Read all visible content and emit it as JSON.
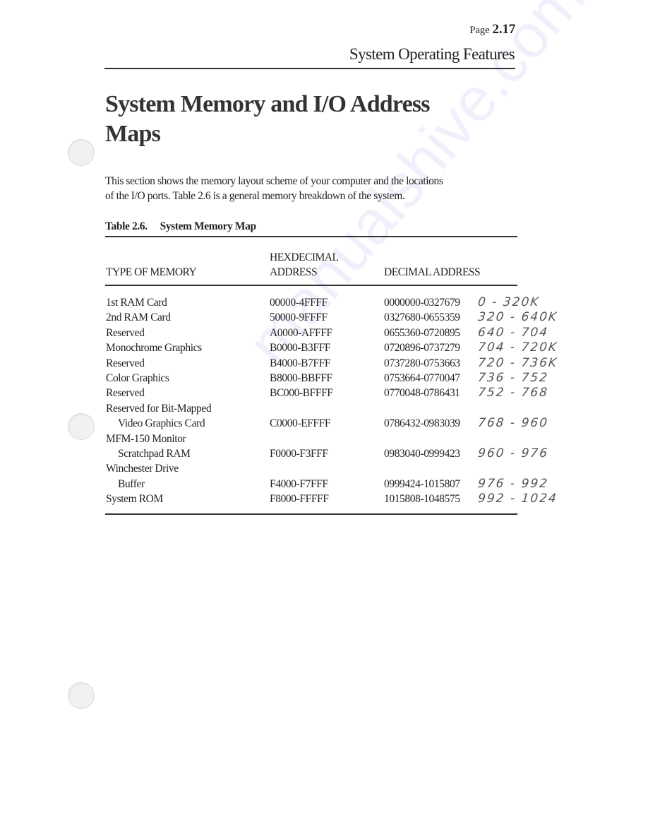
{
  "header": {
    "page_label": "Page",
    "page_number": "2.17",
    "section_title": "System Operating Features"
  },
  "title": {
    "line1": "System Memory and I/O Address",
    "line2": "Maps"
  },
  "intro": {
    "line1": "This section shows the memory layout scheme of your computer and the locations",
    "line2": "of the I/O ports. Table 2.6 is a general memory breakdown of the system."
  },
  "table": {
    "caption_number": "Table 2.6.",
    "caption_title": "System Memory Map",
    "headers": {
      "type": "TYPE OF MEMORY",
      "hex_line1": "HEXDECIMAL",
      "hex_line2": "ADDRESS",
      "decimal": "DECIMAL ADDRESS"
    },
    "rows": [
      {
        "type": "1st RAM Card",
        "hex": "00000-4FFFF",
        "decimal": "0000000-0327679",
        "note": "0 - 320K"
      },
      {
        "type": "2nd RAM Card",
        "hex": "50000-9FFFF",
        "decimal": "0327680-0655359",
        "note": "320 - 640K"
      },
      {
        "type": "Reserved",
        "hex": "A0000-AFFFF",
        "decimal": "0655360-0720895",
        "note": "640 - 704"
      },
      {
        "type": "Monochrome Graphics",
        "hex": "B0000-B3FFF",
        "decimal": "0720896-0737279",
        "note": "704 - 720K"
      },
      {
        "type": "Reserved",
        "hex": "B4000-B7FFF",
        "decimal": "0737280-0753663",
        "note": "720 - 736K"
      },
      {
        "type": "Color Graphics",
        "hex": "B8000-BBFFF",
        "decimal": "0753664-0770047",
        "note": "736 - 752"
      },
      {
        "type": "Reserved",
        "hex": "BC000-BFFFF",
        "decimal": "0770048-0786431",
        "note": "752 - 768"
      },
      {
        "type": "Reserved for Bit-Mapped",
        "type2": "Video Graphics Card",
        "hex": "C0000-EFFFF",
        "decimal": "0786432-0983039",
        "note": "768 - 960"
      },
      {
        "type": "MFM-150 Monitor",
        "type2": "Scratchpad RAM",
        "hex": "F0000-F3FFF",
        "decimal": "0983040-0999423",
        "note": "960 - 976"
      },
      {
        "type": "Winchester Drive",
        "type2": "Buffer",
        "hex": "F4000-F7FFF",
        "decimal": "0999424-1015807",
        "note": "976 - 992"
      },
      {
        "type": "System ROM",
        "hex": "F8000-FFFFF",
        "decimal": "1015808-1048575",
        "note": "992 - 1024"
      }
    ]
  },
  "watermark": "manualshive.com"
}
